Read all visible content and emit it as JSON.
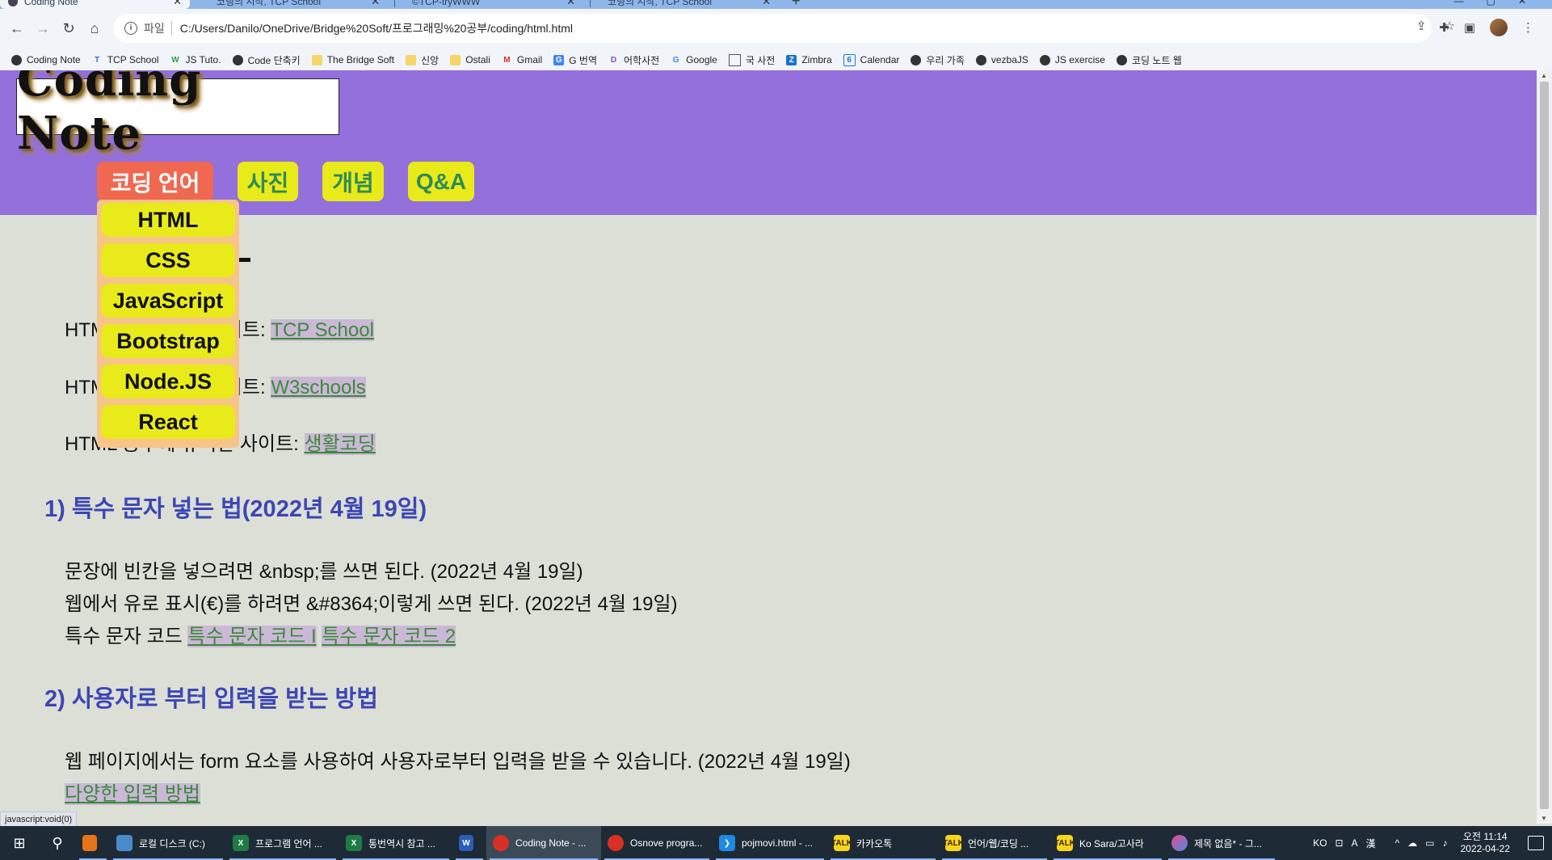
{
  "browser": {
    "tabs": [
      {
        "title": "Coding Note",
        "active": true
      },
      {
        "title": "코딩의 시작, TCP School",
        "active": false
      },
      {
        "title": "©TCP-tryWWW",
        "active": false
      },
      {
        "title": "코딩의 시작, TCP School",
        "active": false
      }
    ],
    "new_tab": "+",
    "address": {
      "scheme": "파일",
      "url": "C:/Users/Danilo/OneDrive/Bridge%20Soft/프로그래밍%20공부/coding/html.html"
    },
    "bookmarks": [
      {
        "label": "Coding Note",
        "icon": "globe-icon"
      },
      {
        "label": "TCP School",
        "icon": "t-icon"
      },
      {
        "label": "JS Tuto.",
        "icon": "w3-icon"
      },
      {
        "label": "Code 단축키",
        "icon": "code-icon"
      },
      {
        "label": "The Bridge Soft",
        "icon": "folder-icon"
      },
      {
        "label": "신앙",
        "icon": "folder-icon"
      },
      {
        "label": "Ostali",
        "icon": "folder-icon"
      },
      {
        "label": "Gmail",
        "icon": "gmail-icon"
      },
      {
        "label": "G 번역",
        "icon": "translate-icon"
      },
      {
        "label": "어학사전",
        "icon": "dictionary-icon"
      },
      {
        "label": "Google",
        "icon": "google-icon"
      },
      {
        "label": "국 사전",
        "icon": "dictionary-icon"
      },
      {
        "label": "Zimbra",
        "icon": "zimbra-icon"
      },
      {
        "label": "Calendar",
        "icon": "calendar-icon"
      },
      {
        "label": "우리 가족",
        "icon": "globe-icon"
      },
      {
        "label": "vezbaJS",
        "icon": "globe-icon"
      },
      {
        "label": "JS exercise",
        "icon": "globe-icon"
      },
      {
        "label": "코딩 노트 웹",
        "icon": "globe-icon"
      }
    ]
  },
  "site": {
    "logo": "Coding Note",
    "menu": [
      "코딩 언어",
      "사진",
      "개념",
      "Q&A"
    ],
    "dropdown": [
      "HTML",
      "CSS",
      "JavaScript",
      "Bootstrap",
      "Node.JS",
      "React"
    ]
  },
  "content": {
    "resource_lines": [
      {
        "prefix": "HTM",
        "suffix": "한 사이트: ",
        "link": "TCP School"
      },
      {
        "prefix": "HTM",
        "suffix": "한 사이트: ",
        "link": "W3schools"
      },
      {
        "prefix": "HTML 공부에 유익한 사이트: ",
        "suffix": "",
        "link": "생활코딩"
      }
    ],
    "section1": {
      "heading": "1) 특수 문자 넣는 법(2022년 4월 19일)",
      "line1": "문장에 빈칸을 넣으려면 &nbsp;를 쓰면 된다. (2022년 4월 19일)",
      "line2": "웹에서 유로 표시(€)를 하려면 &#8364;이렇게 쓰면 된다. (2022년 4월 19일)",
      "line3_prefix": "특수 문자 코드 ",
      "link1": "특수 문자 코드 I",
      "link2": "특수 문자 코드 2"
    },
    "section2": {
      "heading": "2) 사용자로 부터 입력을 받는 방법",
      "line1": "웹 페이지에서는 form 요소를 사용하여 사용자로부터 입력을 받을 수 있습니다. (2022년 4월 19일)",
      "link": "다양한 입력 방법"
    }
  },
  "status_text": "javascript:void(0)",
  "taskbar": {
    "apps": [
      {
        "label": "",
        "icon": "app-icon"
      },
      {
        "label": "로컬 디스크 (C:)",
        "icon": "drive-icon"
      },
      {
        "label": "프로그램 언어 ...",
        "icon": "excel-icon"
      },
      {
        "label": "통번역시 참고 ...",
        "icon": "excel-icon"
      },
      {
        "label": "",
        "icon": "word-icon"
      },
      {
        "label": "Coding Note - ...",
        "icon": "chrome-icon"
      },
      {
        "label": "Osnove progra...",
        "icon": "chrome-icon"
      },
      {
        "label": "pojmovi.html - ...",
        "icon": "vscode-icon"
      },
      {
        "label": "카카오톡",
        "icon": "kakao-icon"
      },
      {
        "label": "언어/웹/코딩 ...",
        "icon": "kakao-icon"
      },
      {
        "label": "Ko Sara/고사라",
        "icon": "kakao-icon"
      },
      {
        "label": "제목 없음* - 그...",
        "icon": "paint-icon"
      }
    ],
    "tray": {
      "lang": "KO",
      "ime1": "A",
      "ime2": "漢",
      "time": "오전 11:14",
      "date": "2022-04-22"
    }
  },
  "colors": {
    "header_bg": "#9370db",
    "menu_bg": "#e8ea1a",
    "menu_active_bg": "#f06850",
    "page_bg": "#dcdfd6",
    "heading_color": "#3c46b4",
    "link_color": "#3a8a3a"
  }
}
